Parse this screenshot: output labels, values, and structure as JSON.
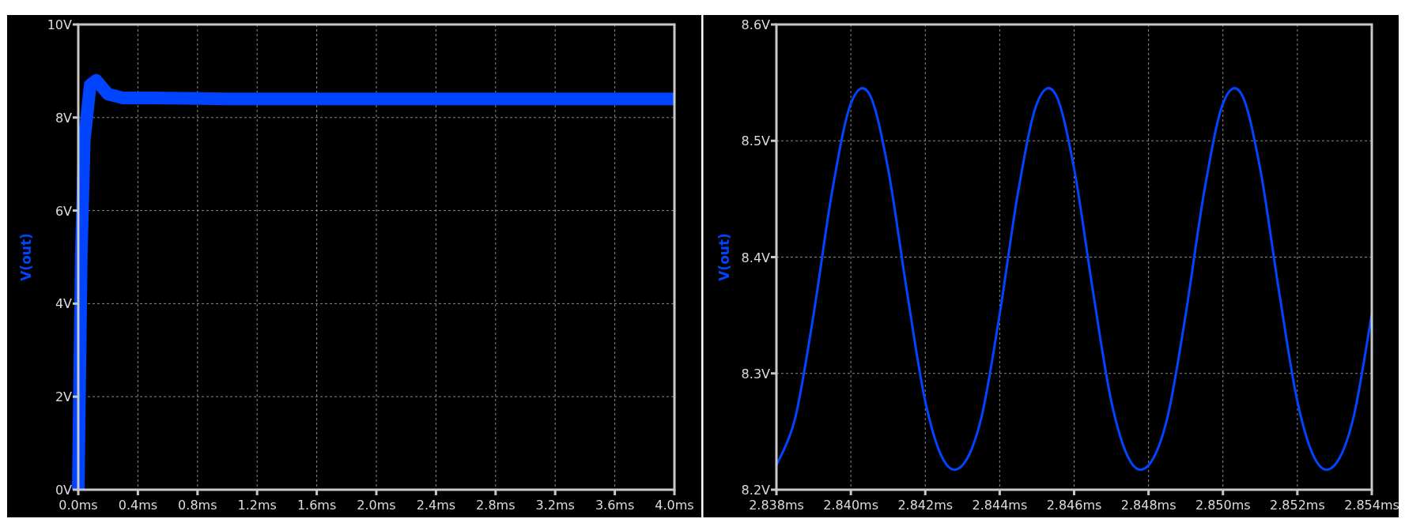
{
  "panels": [
    {
      "chart_data": {
        "type": "line",
        "ylabel": "V(out)",
        "x": [
          0,
          0.02,
          0.04,
          0.08,
          0.12,
          0.2,
          0.3,
          0.5,
          1.0,
          2.0,
          3.0,
          4.0
        ],
        "grid": true,
        "series": [
          {
            "color": "#0044ff",
            "values": [
              0,
              5,
              7.5,
              8.7,
              8.8,
              8.5,
              8.42,
              8.42,
              8.4,
              8.4,
              8.4,
              8.4
            ]
          }
        ],
        "xlim": [
          0,
          4
        ],
        "ylim": [
          0,
          10
        ],
        "xticks": [
          {
            "value": 0,
            "label": "0.0ms"
          },
          {
            "value": 0.4,
            "label": "0.4ms"
          },
          {
            "value": 0.8,
            "label": "0.8ms"
          },
          {
            "value": 1.2,
            "label": "1.2ms"
          },
          {
            "value": 1.6,
            "label": "1.6ms"
          },
          {
            "value": 2.0,
            "label": "2.0ms"
          },
          {
            "value": 2.4,
            "label": "2.4ms"
          },
          {
            "value": 2.8,
            "label": "2.8ms"
          },
          {
            "value": 3.2,
            "label": "3.2ms"
          },
          {
            "value": 3.6,
            "label": "3.6ms"
          },
          {
            "value": 4.0,
            "label": "4.0ms"
          }
        ],
        "yticks": [
          {
            "value": 0,
            "label": "0V"
          },
          {
            "value": 2,
            "label": "2V"
          },
          {
            "value": 4,
            "label": "4V"
          },
          {
            "value": 6,
            "label": "6V"
          },
          {
            "value": 8,
            "label": "8V"
          },
          {
            "value": 10,
            "label": "10V"
          }
        ]
      }
    },
    {
      "chart_data": {
        "type": "line",
        "ylabel": "V(out)",
        "x": [
          2.838,
          2.8385,
          2.839,
          2.8395,
          2.84,
          2.8405,
          2.841,
          2.8415,
          2.842,
          2.8425,
          2.843,
          2.8435,
          2.844,
          2.8445,
          2.845,
          2.8455,
          2.846,
          2.8465,
          2.847,
          2.8475,
          2.848,
          2.8485,
          2.849,
          2.8495,
          2.85,
          2.8505,
          2.851,
          2.8515,
          2.852,
          2.8525,
          2.853,
          2.8535,
          2.854
        ],
        "grid": true,
        "series": [
          {
            "color": "#0044ff",
            "values": [
              8.221,
              8.261,
              8.351,
              8.457,
              8.532,
              8.54,
              8.476,
              8.372,
              8.276,
              8.225,
              8.221,
              8.261,
              8.351,
              8.457,
              8.532,
              8.54,
              8.476,
              8.372,
              8.276,
              8.225,
              8.221,
              8.261,
              8.351,
              8.457,
              8.532,
              8.54,
              8.476,
              8.372,
              8.276,
              8.225,
              8.221,
              8.261,
              8.351
            ]
          }
        ],
        "xlim": [
          2.838,
          2.854
        ],
        "ylim": [
          8.2,
          8.6
        ],
        "xticks": [
          {
            "value": 2.838,
            "label": "2.838ms"
          },
          {
            "value": 2.84,
            "label": "2.840ms"
          },
          {
            "value": 2.842,
            "label": "2.842ms"
          },
          {
            "value": 2.844,
            "label": "2.844ms"
          },
          {
            "value": 2.846,
            "label": "2.846ms"
          },
          {
            "value": 2.848,
            "label": "2.848ms"
          },
          {
            "value": 2.85,
            "label": "2.850ms"
          },
          {
            "value": 2.852,
            "label": "2.852ms"
          },
          {
            "value": 2.854,
            "label": "2.854ms"
          }
        ],
        "yticks": [
          {
            "value": 8.2,
            "label": "8.2V"
          },
          {
            "value": 8.3,
            "label": "8.3V"
          },
          {
            "value": 8.4,
            "label": "8.4V"
          },
          {
            "value": 8.5,
            "label": "8.5V"
          },
          {
            "value": 8.6,
            "label": "8.6V"
          }
        ]
      }
    }
  ]
}
